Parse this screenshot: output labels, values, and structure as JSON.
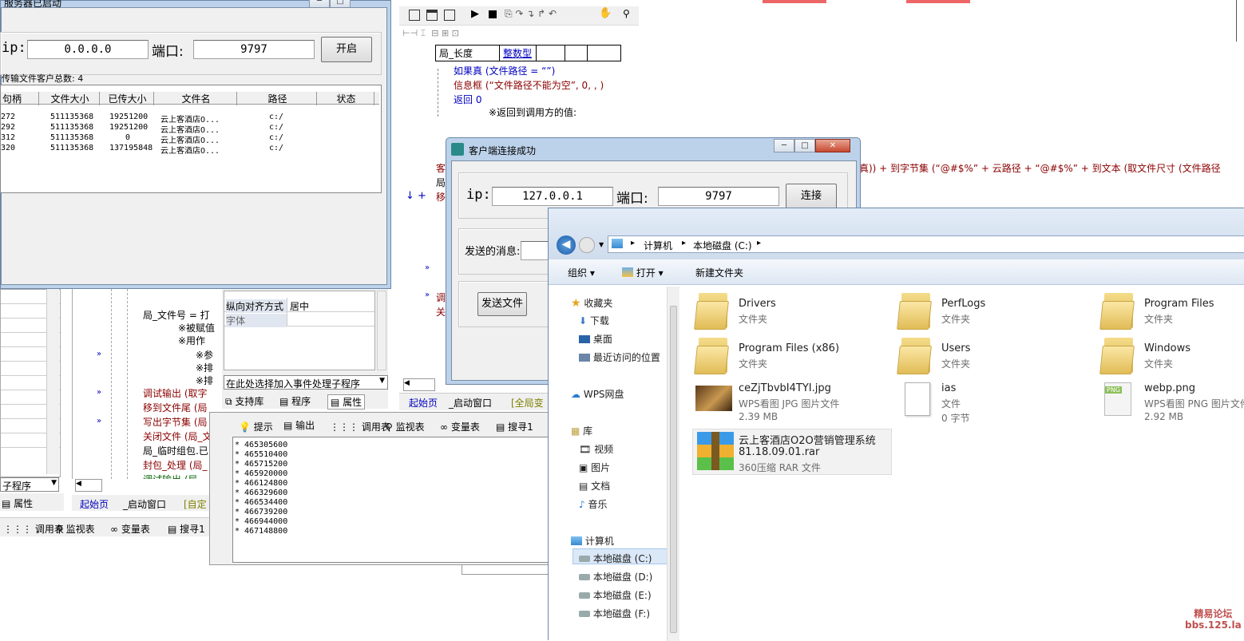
{
  "server_window": {
    "title": "服务器已启动",
    "ip_label": "ip:",
    "ip_value": "0.0.0.0",
    "port_label": "端口:",
    "port_value": "9797",
    "start_button": "开启",
    "client_count_label": "传输文件客户总数: 4",
    "columns": [
      "句柄",
      "文件大小",
      "已传大小",
      "文件名",
      "路径",
      "状态"
    ],
    "rows": [
      [
        "272",
        "511135368",
        "19251200",
        "云上客酒店O...",
        "c:/",
        ""
      ],
      [
        "292",
        "511135368",
        "19251200",
        "云上客酒店O...",
        "c:/",
        ""
      ],
      [
        "312",
        "511135368",
        "0",
        "云上客酒店O...",
        "c:/",
        ""
      ],
      [
        "320",
        "511135368",
        "137195848",
        "云上客酒店O...",
        "c:/",
        ""
      ]
    ]
  },
  "ide": {
    "var_table": {
      "name": "局_长度",
      "type": "整数型"
    },
    "code_top": [
      "如果真 (文件路径 = “”)",
      "信息框 (“文件路径不能为空”, 0, , )",
      "返回 0",
      "※返回到调用方的值:"
    ],
    "code_right_line": "真)) + 到字节集 (“@#$%” + 云路径 + “@#$%” + 到文本 (取文件尺寸 (文件路径",
    "code_left_fragments": [
      "客",
      "局",
      "移",
      "调",
      "关"
    ],
    "code_lower": [
      "局_文件号 = 打",
      "※被赋值",
      "※用作",
      "※参",
      "※排",
      "※排",
      "调试输出 (取字",
      "移到文件尾 (局",
      "写出字节集 (局",
      "关闭文件 (局_文",
      "局_临时组包.已",
      "封包_处理 (局_",
      "调试输出 (局"
    ],
    "props": [
      {
        "name": "纵向对齐方式",
        "value": "居中"
      },
      {
        "name": "字体",
        "value": ""
      }
    ],
    "event_select": "在此处选择加入事件处理子程序",
    "panel_tabs": [
      "支持库",
      "程序",
      "属性"
    ],
    "left_tabs": [
      "子程序",
      "属性"
    ],
    "doc_tabs": [
      "起始页",
      "_启动窗口",
      "[全局变"
    ],
    "doc_tabs_lower": [
      "起始页",
      "_启动窗口",
      "[自定"
    ],
    "output_tabs": [
      "提示",
      "输出",
      "调用表",
      "监视表",
      "变量表",
      "搜寻1"
    ],
    "left_output_tabs": [
      "调用表",
      "监视表",
      "变量表",
      "搜寻1"
    ],
    "output_lines": [
      "* 465305600",
      "* 465510400",
      "* 465715200",
      "* 465920000",
      "* 466124800",
      "* 466329600",
      "* 466534400",
      "* 466739200",
      "* 466944000",
      "* 467148800"
    ]
  },
  "client_window": {
    "title": "客户端连接成功",
    "ip_label": "ip:",
    "ip_value": "127.0.0.1",
    "port_label": "端口:",
    "port_value": "9797",
    "connect_button": "连接",
    "message_label": "发送的消息:",
    "send_file_button": "发送文件"
  },
  "explorer": {
    "breadcrumb": [
      "计算机",
      "本地磁盘 (C:)"
    ],
    "toolbar": {
      "organize": "组织",
      "open": "打开",
      "new_folder": "新建文件夹"
    },
    "nav": {
      "favorites": "收藏夹",
      "fav_items": [
        "下载",
        "桌面",
        "最近访问的位置"
      ],
      "wps": "WPS网盘",
      "library": "库",
      "lib_items": [
        "视频",
        "图片",
        "文档",
        "音乐"
      ],
      "computer": "计算机",
      "drives": [
        "本地磁盘 (C:)",
        "本地磁盘 (D:)",
        "本地磁盘 (E:)",
        "本地磁盘 (F:)"
      ]
    },
    "items": [
      {
        "name": "Drivers",
        "type": "文件夹",
        "size": ""
      },
      {
        "name": "PerfLogs",
        "type": "文件夹",
        "size": ""
      },
      {
        "name": "Program Files",
        "type": "文件夹",
        "size": ""
      },
      {
        "name": "Program Files (x86)",
        "type": "文件夹",
        "size": ""
      },
      {
        "name": "Users",
        "type": "文件夹",
        "size": ""
      },
      {
        "name": "Windows",
        "type": "文件夹",
        "size": ""
      },
      {
        "name": "ceZjTbvbI4TYI.jpg",
        "type": "WPS看图 JPG 图片文件",
        "size": "2.39 MB"
      },
      {
        "name": "ias",
        "type": "文件",
        "size": "0 字节"
      },
      {
        "name": "webp.png",
        "type": "WPS看图 PNG 图片文件",
        "size": "2.92 MB"
      },
      {
        "name": "云上客酒店O2O营销管理系统",
        "name2": "81.18.09.01.rar",
        "type": "360压缩 RAR 文件",
        "size": ""
      }
    ]
  },
  "watermark": {
    "line1": "精易论坛",
    "line2": "bbs.125.la"
  },
  "colors": {
    "keyword": "#0000c0",
    "function": "#8b0000",
    "red_title": "#e00000"
  }
}
